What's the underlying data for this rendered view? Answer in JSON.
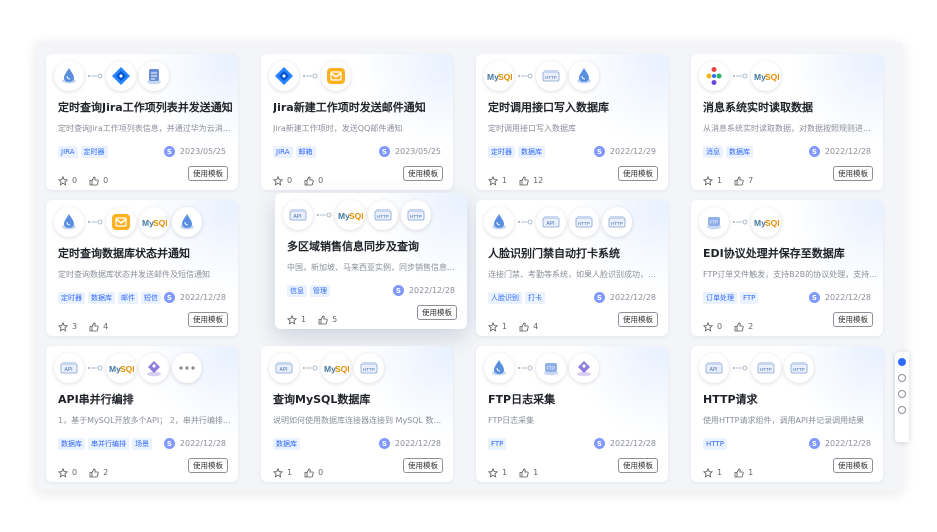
{
  "labels": {
    "use_button": "使用模板"
  },
  "colors": {
    "accent": "#2f6bff",
    "tag_bg": "#eaf1ff",
    "page_bg": "#f3f5f8"
  },
  "cards": [
    {
      "title": "定时查询Jira工作项列表并发送通知",
      "desc": "定时查询Jira工作项列表信息，并通过华为云消...",
      "tags": [
        "JIRA",
        "定时器"
      ],
      "date": "2023/05/25",
      "stars": "0",
      "likes": "0",
      "author_initial": "S",
      "icons": [
        "drop-icon",
        "jira-icon",
        "doc-icon"
      ]
    },
    {
      "title": "Jira新建工作项时发送邮件通知",
      "desc": "Jira新建工作项时，发送QQ邮件通知",
      "tags": [
        "JIRA",
        "邮箱"
      ],
      "date": "2023/05/25",
      "stars": "0",
      "likes": "0",
      "author_initial": "S",
      "icons": [
        "jira-icon",
        "mail-icon"
      ]
    },
    {
      "title": "定时调用接口写入数据库",
      "desc": "定时调用接口写入数据库",
      "tags": [
        "定时器",
        "数据库"
      ],
      "date": "2022/12/29",
      "stars": "1",
      "likes": "12",
      "author_initial": "S",
      "icons": [
        "mysql-icon",
        "http-icon",
        "drop-icon"
      ]
    },
    {
      "title": "消息系统实时读取数据",
      "desc": "从消息系统实时读取数据，对数据按照规则进...",
      "tags": [
        "消息",
        "数据库"
      ],
      "date": "2022/12/28",
      "stars": "1",
      "likes": "7",
      "author_initial": "S",
      "icons": [
        "kafka-icon",
        "mysql-icon"
      ]
    },
    {
      "title": "定时查询数据库状态并通知",
      "desc": "定时查询数据库状态并发送邮件及短信通知",
      "tags": [
        "定时器",
        "数据库",
        "邮件",
        "短信"
      ],
      "date": "2022/12/28",
      "stars": "3",
      "likes": "4",
      "author_initial": "S",
      "icons": [
        "drop-icon",
        "mail-icon",
        "mysql-icon",
        "drop-icon"
      ]
    },
    {
      "title": "多区域销售信息同步及查询",
      "desc": "中国，新加坡、马来西亚实例，同步销售信息...",
      "tags": [
        "信息",
        "管理"
      ],
      "date": "2022/12/28",
      "stars": "1",
      "likes": "5",
      "author_initial": "S",
      "icons": [
        "api-icon",
        "mysql-icon",
        "http-icon",
        "http-icon"
      ]
    },
    {
      "title": "人脸识别门禁自动打卡系统",
      "desc": "连接门禁、考勤等系统，如果人脸识别成功，...",
      "tags": [
        "人脸识别",
        "打卡"
      ],
      "date": "2022/12/28",
      "stars": "1",
      "likes": "4",
      "author_initial": "S",
      "icons": [
        "drop-icon",
        "api-icon",
        "http-icon",
        "http-icon"
      ]
    },
    {
      "title": "EDI协议处理并保存至数据库",
      "desc": "FTP订单文件触发，支持B2B的协议处理，支持...",
      "tags": [
        "订单处理",
        "FTP"
      ],
      "date": "2022/12/28",
      "stars": "0",
      "likes": "2",
      "author_initial": "S",
      "icons": [
        "ftp-icon",
        "mysql-icon"
      ]
    },
    {
      "title": "API串并行编排",
      "desc": "1，基于MySQL开放多个API；  2，串并行编排...",
      "tags": [
        "数据库",
        "串并行编排",
        "场景"
      ],
      "date": "2022/12/28",
      "stars": "0",
      "likes": "2",
      "author_initial": "S",
      "icons": [
        "api-icon",
        "mysql-icon",
        "tag-icon",
        "more-icon"
      ]
    },
    {
      "title": "查询MySQL数据库",
      "desc": "说明如何使用数据库连接器连接到 MySQL 数...",
      "tags": [
        "数据库"
      ],
      "date": "2022/12/28",
      "stars": "1",
      "likes": "0",
      "author_initial": "S",
      "icons": [
        "api-icon",
        "mysql-icon",
        "http-icon"
      ]
    },
    {
      "title": "FTP日志采集",
      "desc": "FTP日志采集",
      "tags": [
        "FTP"
      ],
      "date": "2022/12/28",
      "stars": "1",
      "likes": "1",
      "author_initial": "S",
      "icons": [
        "drop-icon",
        "ftp-icon",
        "tag-icon"
      ]
    },
    {
      "title": "HTTP请求",
      "desc": "使用HTTP请求组件，调用API并记录调用结果",
      "tags": [
        "HTTP"
      ],
      "date": "2022/12/28",
      "stars": "1",
      "likes": "1",
      "author_initial": "S",
      "icons": [
        "api-icon",
        "http-icon",
        "http-icon"
      ]
    }
  ]
}
